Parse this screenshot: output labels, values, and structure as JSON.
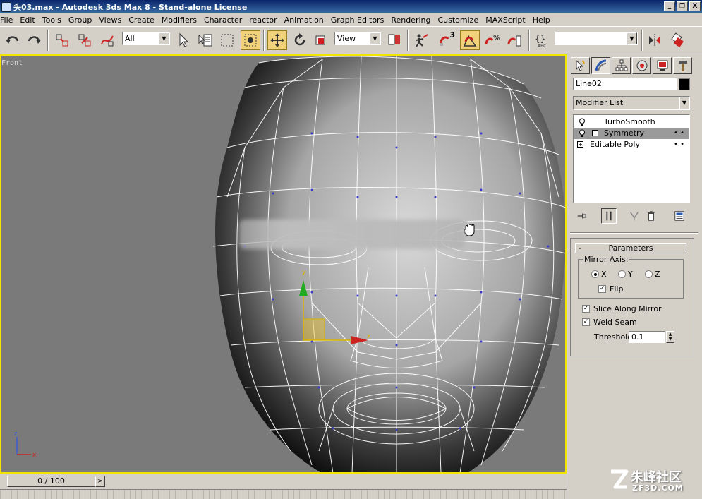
{
  "window": {
    "title": "头03.max - Autodesk 3ds Max 8  - Stand-alone License",
    "controls": [
      "_",
      "❐",
      "X"
    ]
  },
  "menu": [
    "File",
    "Edit",
    "Tools",
    "Group",
    "Views",
    "Create",
    "Modifiers",
    "Character",
    "reactor",
    "Animation",
    "Graph Editors",
    "Rendering",
    "Customize",
    "MAXScript",
    "Help"
  ],
  "toolbar": {
    "selection_filter": "All",
    "reference_coordinate": "View",
    "snap_value": "3",
    "named_selection": ""
  },
  "viewport": {
    "label": "Front",
    "axis_x": "x",
    "axis_y": "y",
    "axis_z": "z",
    "border_color": "#f5e400"
  },
  "timeline": {
    "frame": "0 / 100",
    "next": ">"
  },
  "panel": {
    "object_name": "Line02",
    "object_color": "#000000",
    "modifier_list": "Modifier List",
    "stack": [
      {
        "label": "TurboSmooth",
        "selected": false
      },
      {
        "label": "Symmetry",
        "selected": true
      },
      {
        "label": "Editable Poly",
        "selected": false
      }
    ],
    "rollout": {
      "title": "Parameters",
      "collapse": "-",
      "mirror_axis_label": "Mirror Axis:",
      "axes": [
        {
          "label": "X",
          "checked": true
        },
        {
          "label": "Y",
          "checked": false
        },
        {
          "label": "Z",
          "checked": false
        }
      ],
      "flip": {
        "label": "Flip",
        "checked": true
      },
      "slice": {
        "label": "Slice Along Mirror",
        "checked": true
      },
      "weld": {
        "label": "Weld Seam",
        "checked": true
      },
      "threshold_label": "Threshold:",
      "threshold_value": "0.1"
    }
  },
  "watermark": {
    "main": "朱峰社区",
    "sub": "ZF3D.COM"
  }
}
